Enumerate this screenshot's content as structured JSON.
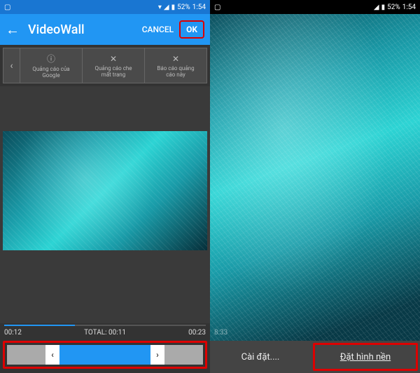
{
  "left": {
    "status": {
      "battery": "52%",
      "time": "1:54"
    },
    "appbar": {
      "title": "VideoWall",
      "cancel": "CANCEL",
      "ok": "OK"
    },
    "ads": {
      "item1_line1": "Quảng cáo của",
      "item1_line2": "Google",
      "item2_line1": "Quảng cáo che",
      "item2_line2": "mất trang",
      "item3_line1": "Báo cáo quảng",
      "item3_line2": "cáo này"
    },
    "timeline": {
      "start": "00:12",
      "total": "TOTAL: 00:11",
      "end": "00:23"
    }
  },
  "right": {
    "status": {
      "battery": "52%",
      "time": "1:54"
    },
    "wp_time": "8:33",
    "buttons": {
      "settings": "Cài đặt....",
      "set_wallpaper": "Đặt hình nền"
    }
  }
}
